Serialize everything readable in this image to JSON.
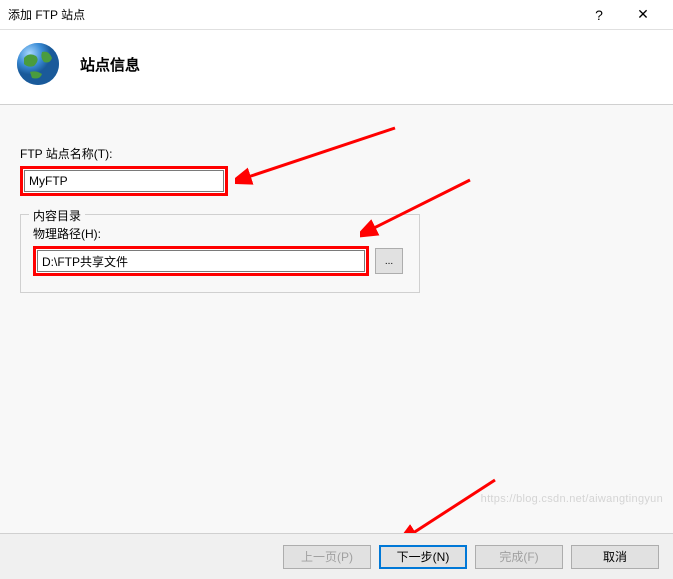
{
  "titlebar": {
    "title": "添加 FTP 站点",
    "help": "?",
    "close": "✕"
  },
  "header": {
    "title": "站点信息"
  },
  "form": {
    "siteNameLabel": "FTP 站点名称(T):",
    "siteNameValue": "MyFTP",
    "contentDirLegend": "内容目录",
    "physicalPathLabel": "物理路径(H):",
    "physicalPathValue": "D:\\FTP共享文件",
    "browseLabel": "..."
  },
  "footer": {
    "prev": "上一页(P)",
    "next": "下一步(N)",
    "finish": "完成(F)",
    "cancel": "取消"
  },
  "watermark": "https://blog.csdn.net/aiwangtingyun"
}
